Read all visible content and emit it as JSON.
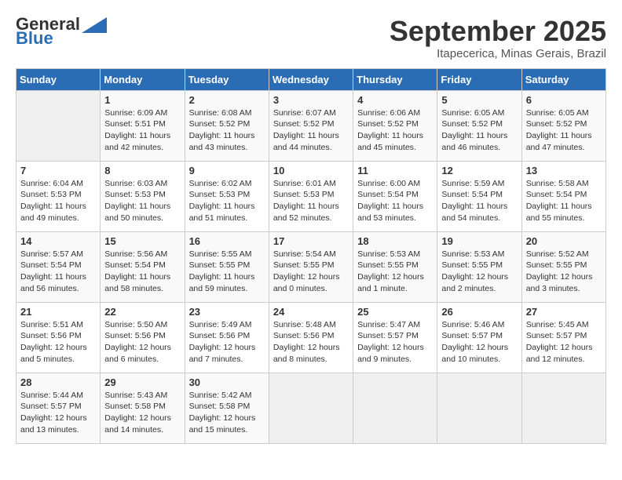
{
  "header": {
    "logo_general": "General",
    "logo_blue": "Blue",
    "title": "September 2025",
    "subtitle": "Itapecerica, Minas Gerais, Brazil"
  },
  "weekdays": [
    "Sunday",
    "Monday",
    "Tuesday",
    "Wednesday",
    "Thursday",
    "Friday",
    "Saturday"
  ],
  "weeks": [
    [
      {
        "day": "",
        "info": ""
      },
      {
        "day": "1",
        "info": "Sunrise: 6:09 AM\nSunset: 5:51 PM\nDaylight: 11 hours\nand 42 minutes."
      },
      {
        "day": "2",
        "info": "Sunrise: 6:08 AM\nSunset: 5:52 PM\nDaylight: 11 hours\nand 43 minutes."
      },
      {
        "day": "3",
        "info": "Sunrise: 6:07 AM\nSunset: 5:52 PM\nDaylight: 11 hours\nand 44 minutes."
      },
      {
        "day": "4",
        "info": "Sunrise: 6:06 AM\nSunset: 5:52 PM\nDaylight: 11 hours\nand 45 minutes."
      },
      {
        "day": "5",
        "info": "Sunrise: 6:05 AM\nSunset: 5:52 PM\nDaylight: 11 hours\nand 46 minutes."
      },
      {
        "day": "6",
        "info": "Sunrise: 6:05 AM\nSunset: 5:52 PM\nDaylight: 11 hours\nand 47 minutes."
      }
    ],
    [
      {
        "day": "7",
        "info": "Sunrise: 6:04 AM\nSunset: 5:53 PM\nDaylight: 11 hours\nand 49 minutes."
      },
      {
        "day": "8",
        "info": "Sunrise: 6:03 AM\nSunset: 5:53 PM\nDaylight: 11 hours\nand 50 minutes."
      },
      {
        "day": "9",
        "info": "Sunrise: 6:02 AM\nSunset: 5:53 PM\nDaylight: 11 hours\nand 51 minutes."
      },
      {
        "day": "10",
        "info": "Sunrise: 6:01 AM\nSunset: 5:53 PM\nDaylight: 11 hours\nand 52 minutes."
      },
      {
        "day": "11",
        "info": "Sunrise: 6:00 AM\nSunset: 5:54 PM\nDaylight: 11 hours\nand 53 minutes."
      },
      {
        "day": "12",
        "info": "Sunrise: 5:59 AM\nSunset: 5:54 PM\nDaylight: 11 hours\nand 54 minutes."
      },
      {
        "day": "13",
        "info": "Sunrise: 5:58 AM\nSunset: 5:54 PM\nDaylight: 11 hours\nand 55 minutes."
      }
    ],
    [
      {
        "day": "14",
        "info": "Sunrise: 5:57 AM\nSunset: 5:54 PM\nDaylight: 11 hours\nand 56 minutes."
      },
      {
        "day": "15",
        "info": "Sunrise: 5:56 AM\nSunset: 5:54 PM\nDaylight: 11 hours\nand 58 minutes."
      },
      {
        "day": "16",
        "info": "Sunrise: 5:55 AM\nSunset: 5:55 PM\nDaylight: 11 hours\nand 59 minutes."
      },
      {
        "day": "17",
        "info": "Sunrise: 5:54 AM\nSunset: 5:55 PM\nDaylight: 12 hours\nand 0 minutes."
      },
      {
        "day": "18",
        "info": "Sunrise: 5:53 AM\nSunset: 5:55 PM\nDaylight: 12 hours\nand 1 minute."
      },
      {
        "day": "19",
        "info": "Sunrise: 5:53 AM\nSunset: 5:55 PM\nDaylight: 12 hours\nand 2 minutes."
      },
      {
        "day": "20",
        "info": "Sunrise: 5:52 AM\nSunset: 5:55 PM\nDaylight: 12 hours\nand 3 minutes."
      }
    ],
    [
      {
        "day": "21",
        "info": "Sunrise: 5:51 AM\nSunset: 5:56 PM\nDaylight: 12 hours\nand 5 minutes."
      },
      {
        "day": "22",
        "info": "Sunrise: 5:50 AM\nSunset: 5:56 PM\nDaylight: 12 hours\nand 6 minutes."
      },
      {
        "day": "23",
        "info": "Sunrise: 5:49 AM\nSunset: 5:56 PM\nDaylight: 12 hours\nand 7 minutes."
      },
      {
        "day": "24",
        "info": "Sunrise: 5:48 AM\nSunset: 5:56 PM\nDaylight: 12 hours\nand 8 minutes."
      },
      {
        "day": "25",
        "info": "Sunrise: 5:47 AM\nSunset: 5:57 PM\nDaylight: 12 hours\nand 9 minutes."
      },
      {
        "day": "26",
        "info": "Sunrise: 5:46 AM\nSunset: 5:57 PM\nDaylight: 12 hours\nand 10 minutes."
      },
      {
        "day": "27",
        "info": "Sunrise: 5:45 AM\nSunset: 5:57 PM\nDaylight: 12 hours\nand 12 minutes."
      }
    ],
    [
      {
        "day": "28",
        "info": "Sunrise: 5:44 AM\nSunset: 5:57 PM\nDaylight: 12 hours\nand 13 minutes."
      },
      {
        "day": "29",
        "info": "Sunrise: 5:43 AM\nSunset: 5:58 PM\nDaylight: 12 hours\nand 14 minutes."
      },
      {
        "day": "30",
        "info": "Sunrise: 5:42 AM\nSunset: 5:58 PM\nDaylight: 12 hours\nand 15 minutes."
      },
      {
        "day": "",
        "info": ""
      },
      {
        "day": "",
        "info": ""
      },
      {
        "day": "",
        "info": ""
      },
      {
        "day": "",
        "info": ""
      }
    ]
  ]
}
